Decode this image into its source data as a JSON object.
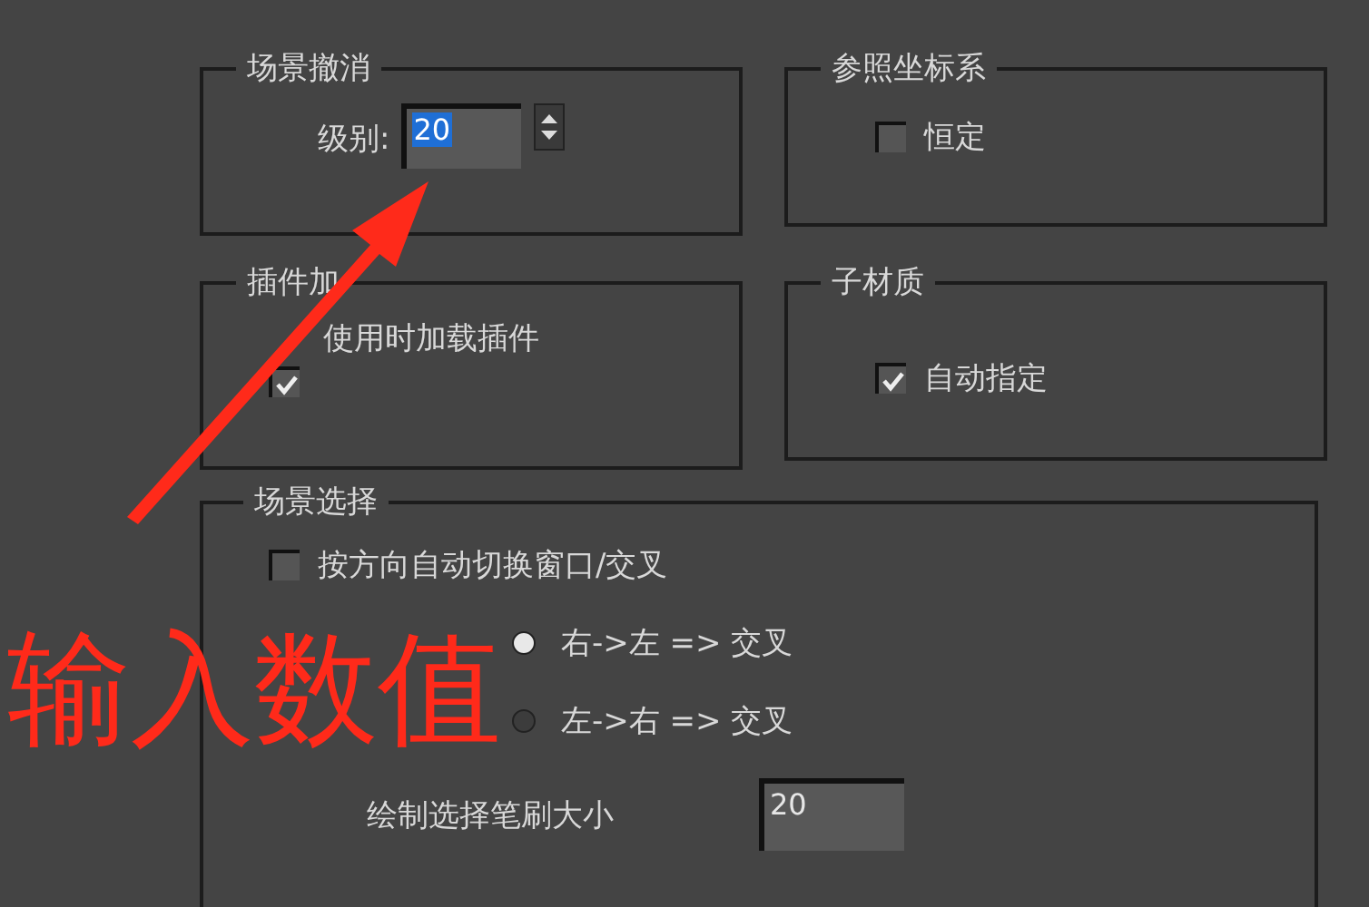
{
  "scene_undo": {
    "title": "场景撤消",
    "label": "级别:",
    "value": "20"
  },
  "reference_coords": {
    "title": "参照坐标系",
    "checkbox": {
      "label": "恒定",
      "checked": false
    }
  },
  "plugin_loading": {
    "title": "插件加",
    "checkbox": {
      "label": "使用时加载插件",
      "checked": true
    }
  },
  "sub_material": {
    "title": "子材质",
    "checkbox": {
      "label": "自动指定",
      "checked": true
    }
  },
  "scene_selection": {
    "title": "场景选择",
    "checkbox": {
      "label": "按方向自动切换窗口/交叉",
      "checked": false
    },
    "radios": [
      {
        "label": "右->左 => 交叉",
        "selected": true
      },
      {
        "label": "左->右 => 交叉",
        "selected": false
      }
    ],
    "brush_size": {
      "label": "绘制选择笔刷大小",
      "value": "20"
    }
  },
  "annotation": {
    "text": "输入数值"
  }
}
